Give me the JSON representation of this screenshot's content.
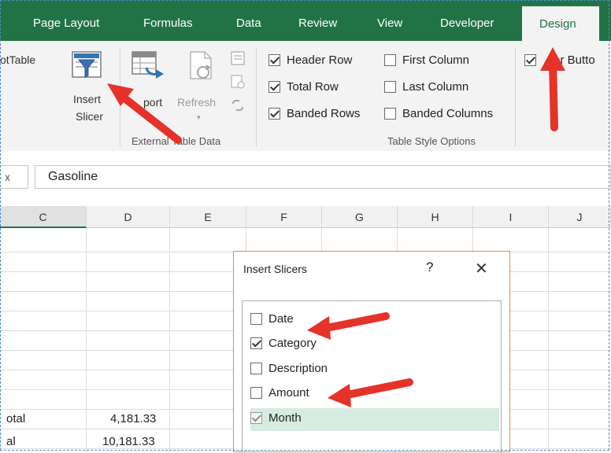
{
  "ribbon": {
    "tabs": [
      "Page Layout",
      "Formulas",
      "Data",
      "Review",
      "View",
      "Developer",
      "Design"
    ],
    "active_tab": "Design",
    "pivot_table_label": "otTable",
    "insert_slicer_label": [
      "Insert",
      "Slicer"
    ],
    "export_label": "port",
    "refresh_label": "Refresh",
    "external_group_label": "External Table Data",
    "style_group_label": "Table Style Options",
    "options": [
      {
        "label": "Header Row",
        "checked": true
      },
      {
        "label": "Total Row",
        "checked": true
      },
      {
        "label": "Banded Rows",
        "checked": true
      },
      {
        "label": "First Column",
        "checked": false
      },
      {
        "label": "Last Column",
        "checked": false
      },
      {
        "label": "Banded Columns",
        "checked": false
      },
      {
        "label": "ter Butto",
        "checked": true
      }
    ]
  },
  "formula_bar": {
    "name_box_fragment": "x",
    "value": "Gasoline"
  },
  "grid": {
    "columns": [
      "C",
      "D",
      "E",
      "F",
      "G",
      "H",
      "I",
      "J"
    ],
    "rows": [
      {
        "label": "otal",
        "value": "4,181.33"
      },
      {
        "label": "al",
        "value": "10,181.33"
      }
    ]
  },
  "dialog": {
    "title": "Insert Slicers",
    "help": "?",
    "close": "✕",
    "items": [
      {
        "label": "Date",
        "checked": false,
        "disabled": false
      },
      {
        "label": "Category",
        "checked": true,
        "disabled": false
      },
      {
        "label": "Description",
        "checked": false,
        "disabled": false
      },
      {
        "label": "Amount",
        "checked": false,
        "disabled": false
      },
      {
        "label": "Month",
        "checked": true,
        "disabled": true
      }
    ]
  },
  "colors": {
    "accent": "#217346",
    "arrow": "#e5332a",
    "dialog_border": "#e0923c",
    "highlight": "#d6ece0"
  }
}
